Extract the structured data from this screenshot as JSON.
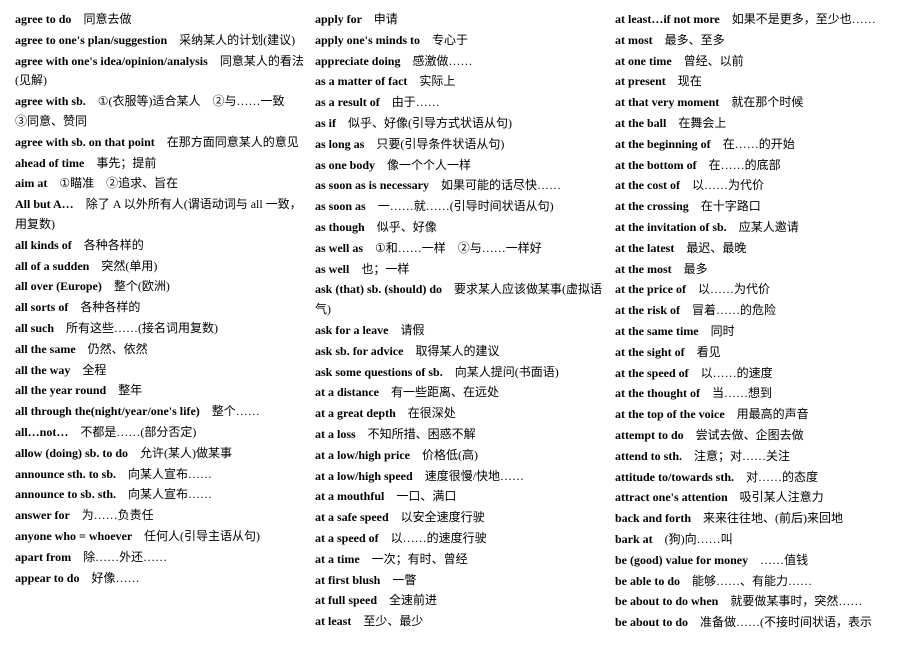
{
  "columns": [
    {
      "id": "col1",
      "entries": [
        {
          "en": "agree to do",
          "cn": "同意去做"
        },
        {
          "en": "agree to one's plan/suggestion",
          "cn": "采纳某人的计划(建议)"
        },
        {
          "en": "agree with one's idea/opinion/analysis",
          "cn": "同意某人的看法(见解)"
        },
        {
          "en": "agree with sb.",
          "cn": "①(衣服等)适合某人　②与……一致　③同意、赞同"
        },
        {
          "en": "agree with sb. on that point",
          "cn": "在那方面同意某人的意见"
        },
        {
          "en": "ahead of time",
          "cn": "事先；提前"
        },
        {
          "en": "aim at",
          "cn": "①瞄准　②追求、旨在"
        },
        {
          "en": "All but A…",
          "cn": "除了 A 以外所有人(谓语动词与 all 一致，用复数)"
        },
        {
          "en": "all kinds of",
          "cn": "各种各样的"
        },
        {
          "en": "all of a sudden",
          "cn": "突然(单用)"
        },
        {
          "en": "all over (Europe)",
          "cn": "整个(欧洲)"
        },
        {
          "en": "all sorts of",
          "cn": "各种各样的"
        },
        {
          "en": "all such",
          "cn": "所有这些……(接名词用复数)"
        },
        {
          "en": "all the same",
          "cn": "仍然、依然"
        },
        {
          "en": "all the way",
          "cn": "全程"
        },
        {
          "en": "all the year round",
          "cn": "整年"
        },
        {
          "en": "all through the(night/year/one's life)",
          "cn": "整个……"
        },
        {
          "en": "all…not…",
          "cn": "不都是……(部分否定)"
        },
        {
          "en": "allow (doing) sb. to do",
          "cn": "允许(某人)做某事"
        },
        {
          "en": "announce sth. to sb.",
          "cn": "向某人宣布……"
        },
        {
          "en": "announce to sb. sth.",
          "cn": "向某人宣布……"
        },
        {
          "en": "answer for",
          "cn": "为……负责任"
        },
        {
          "en": "anyone who = whoever",
          "cn": "任何人(引导主语从句)"
        },
        {
          "en": "apart from",
          "cn": "除……外还……"
        },
        {
          "en": "appear to do",
          "cn": "好像……"
        }
      ]
    },
    {
      "id": "col2",
      "entries": [
        {
          "en": "apply for",
          "cn": "申请"
        },
        {
          "en": "apply one's minds to",
          "cn": "专心于"
        },
        {
          "en": "appreciate doing",
          "cn": "感激做……"
        },
        {
          "en": "as a matter of fact",
          "cn": "实际上"
        },
        {
          "en": "as a result of",
          "cn": "由于……"
        },
        {
          "en": "as if",
          "cn": "似乎、好像(引导方式状语从句)"
        },
        {
          "en": "as long as",
          "cn": "只要(引导条件状语从句)"
        },
        {
          "en": "as one body",
          "cn": "像一个个人一样"
        },
        {
          "en": "as soon as is necessary",
          "cn": "如果可能的话尽快……"
        },
        {
          "en": "as soon as",
          "cn": "一……就……(引导时间状语从句)"
        },
        {
          "en": "as though",
          "cn": "似乎、好像"
        },
        {
          "en": "as well as",
          "cn": "①和……一样　②与……一样好"
        },
        {
          "en": "as well",
          "cn": "也；一样"
        },
        {
          "en": "ask (that) sb. (should) do",
          "cn": "要求某人应该做某事(虚拟语气)"
        },
        {
          "en": "ask for a leave",
          "cn": "请假"
        },
        {
          "en": "ask sb. for advice",
          "cn": "取得某人的建议"
        },
        {
          "en": "ask some questions of sb.",
          "cn": "向某人提问(书面语)"
        },
        {
          "en": "at a distance",
          "cn": "有一些距离、在远处"
        },
        {
          "en": "at a great depth",
          "cn": "在很深处"
        },
        {
          "en": "at a loss",
          "cn": "不知所措、困惑不解"
        },
        {
          "en": "at a low/high price",
          "cn": "价格低(高)"
        },
        {
          "en": "at a low/high speed",
          "cn": "速度很慢/快地……"
        },
        {
          "en": "at a mouthful",
          "cn": "一口、满口"
        },
        {
          "en": "at a safe speed",
          "cn": "以安全速度行驶"
        },
        {
          "en": "at a speed of",
          "cn": "以……的速度行驶"
        },
        {
          "en": "at a time",
          "cn": "一次；有时、曾经"
        },
        {
          "en": "at first blush",
          "cn": "一瞥"
        },
        {
          "en": "at full speed",
          "cn": "全速前进"
        },
        {
          "en": "at least",
          "cn": "至少、最少"
        }
      ]
    },
    {
      "id": "col3",
      "entries": [
        {
          "en": "at least…if not more",
          "cn": "如果不是更多，至少也……"
        },
        {
          "en": "at most",
          "cn": "最多、至多"
        },
        {
          "en": "at one time",
          "cn": "曾经、以前"
        },
        {
          "en": "at present",
          "cn": "现在"
        },
        {
          "en": "at that very moment",
          "cn": "就在那个时候"
        },
        {
          "en": "at the ball",
          "cn": "在舞会上"
        },
        {
          "en": "at the beginning of",
          "cn": "在……的开始"
        },
        {
          "en": "at the bottom of",
          "cn": "在……的底部"
        },
        {
          "en": "at the cost of",
          "cn": "以……为代价"
        },
        {
          "en": "at the crossing",
          "cn": "在十字路口"
        },
        {
          "en": "at the invitation of sb.",
          "cn": "应某人邀请"
        },
        {
          "en": "at the latest",
          "cn": "最迟、最晚"
        },
        {
          "en": "at the most",
          "cn": "最多"
        },
        {
          "en": "at the price of",
          "cn": "以……为代价"
        },
        {
          "en": "at the risk of",
          "cn": "冒着……的危险"
        },
        {
          "en": "at the same time",
          "cn": "同时"
        },
        {
          "en": "at the sight of",
          "cn": "看见"
        },
        {
          "en": "at the speed of",
          "cn": "以……的速度"
        },
        {
          "en": "at the thought of",
          "cn": "当……想到"
        },
        {
          "en": "at the top of the voice",
          "cn": "用最高的声音"
        },
        {
          "en": "attempt to do",
          "cn": "尝试去做、企图去做"
        },
        {
          "en": "attend to sth.",
          "cn": "注意；对……关注"
        },
        {
          "en": "attitude to/towards sth.",
          "cn": "对……的态度"
        },
        {
          "en": "attract one's attention",
          "cn": "吸引某人注意力"
        },
        {
          "en": "back and forth",
          "cn": "来来往往地、(前后)来回地"
        },
        {
          "en": "bark at",
          "cn": "(狗)向……叫"
        },
        {
          "en": "be (good) value for money",
          "cn": "……值钱"
        },
        {
          "en": "be able to do",
          "cn": "能够……、有能力……"
        },
        {
          "en": "be about to do when",
          "cn": "就要做某事时，突然……"
        },
        {
          "en": "be about to do",
          "cn": "准备做……(不接时间状语，表示"
        }
      ]
    }
  ]
}
